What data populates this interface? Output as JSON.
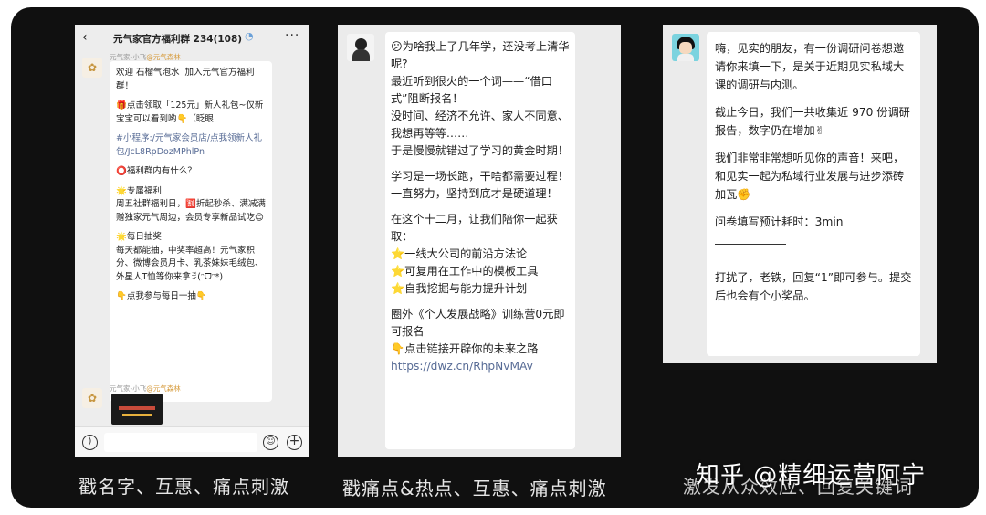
{
  "panel1": {
    "back_glyph": "‹",
    "title": "元气家官方福利群 234(108)",
    "more_glyph": "···",
    "sender": "元气家-小飞",
    "sender_tag": "@元气森林",
    "sender2": "元气家-小飞",
    "sender2_tag": "@元气森林",
    "message": {
      "welcome": "欢迎 石榴气泡水  加入元气官方福利群！",
      "gift": "🎁点击领取「125元」新人礼包~仅新宝宝可以看到哟👇（眨眼",
      "link": "#小程序:/元气家会员店/点我领新人礼包/JcL8RpDozMPhlPn",
      "question": "⭕福利群内有什么？",
      "exclusive": "🌟专属福利\n周五社群福利日，🈹折起秒杀、满减满赠独家元气周边，会员专享新品试吃😊",
      "lottery": "🌟每日抽奖\n每天都能抽，中奖率超高！元气家积分、微博会员月卡、乳茶妹妹毛绒包、外星人T恤等你来拿ꉂ(ᵔᗜᵔ*)",
      "cta": "👇点我参与每日一抽👇"
    }
  },
  "panel2": {
    "message": {
      "p1": "😕为啥我上了几年学，还没考上清华呢?\n最近听到很火的一个词——“借口式”阻断报名！\n没时间、经济不允许、家人不同意、我想再等等……\n于是慢慢就错过了学习的黄金时期！",
      "p2": "学习是一场长跑，干啥都需要过程！\n一直努力，坚持到底才是硬道理！",
      "p3": "在这个十二月，让我们陪你一起获取：\n⭐一线大公司的前沿方法论\n⭐可复用在工作中的模板工具\n⭐自我挖掘与能力提升计划",
      "p4": "圈外《个人发展战略》训练营0元即可报名\n👇点击链接开辟你的未来之路",
      "link": "https://dwz.cn/RhpNvMAv"
    }
  },
  "panel3": {
    "message": {
      "p1": "嗨，见实的朋友，有一份调研问卷想邀请你来填一下，是关于近期见实私域大课的调研与内测。",
      "p2": "截止今日，我们一共收集近 970 份调研报告，数字仍在增加✌",
      "p3": "我们非常非常想听见你的声音！来吧，和见实一起为私域行业发展与进步添砖加瓦✊",
      "p4": "问卷填写预计耗时：3min",
      "p5": "打扰了，老铁，回复“1”即可参与。提交后也会有个小奖品。"
    }
  },
  "captions": {
    "c1": "戳名字、互惠、痛点刺激",
    "c2": "戳痛点&热点、互惠、痛点刺激",
    "c3": "激发从众效应、回复关键词"
  },
  "watermark": "知乎 @精细运营阿宁"
}
